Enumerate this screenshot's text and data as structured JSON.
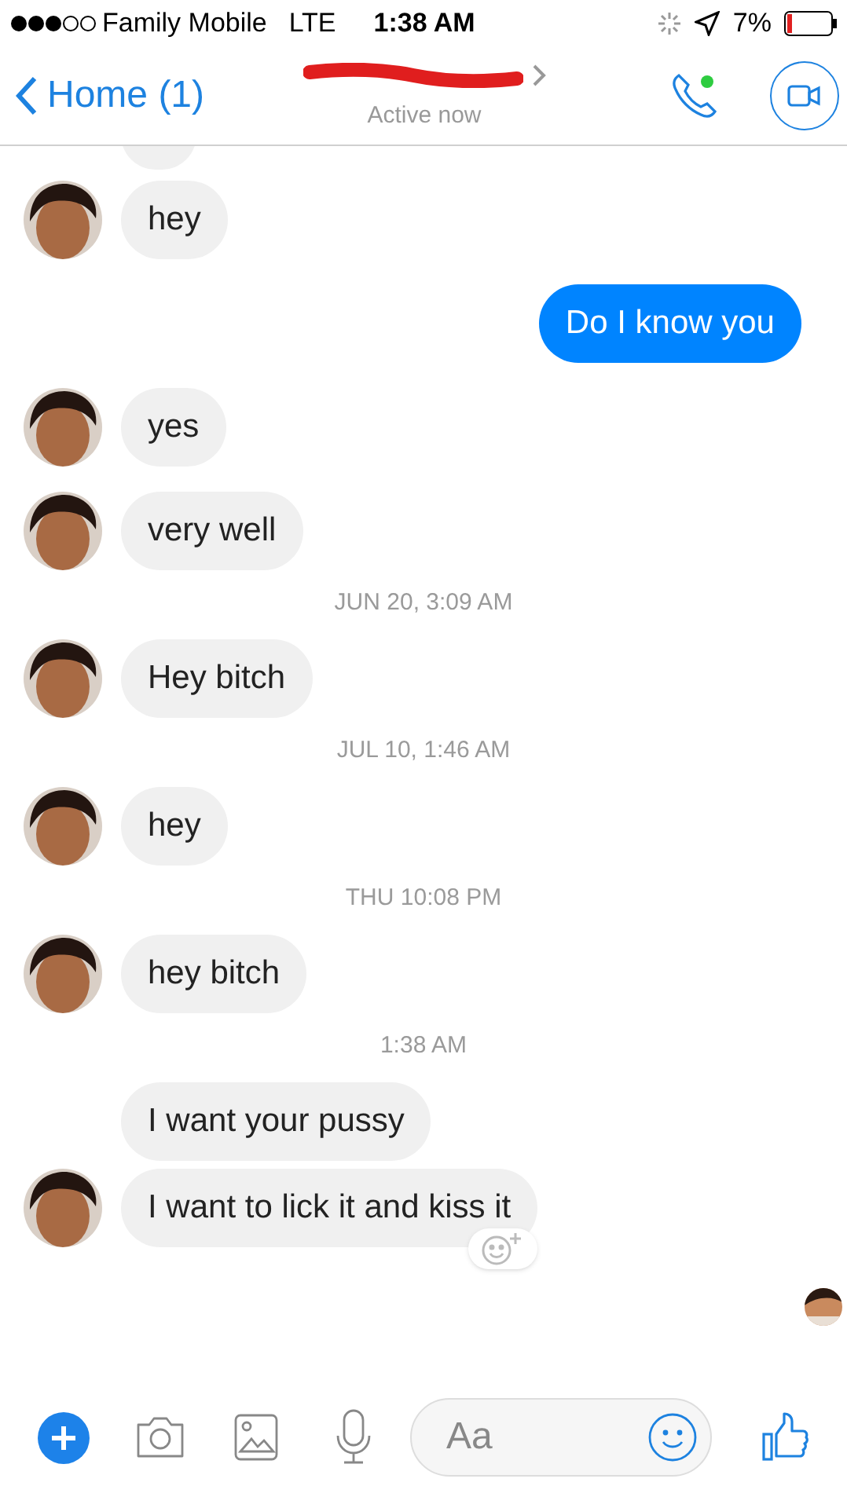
{
  "status_bar": {
    "carrier": "Family Mobile",
    "network": "LTE",
    "time": "1:38 AM",
    "battery": "7%"
  },
  "header": {
    "back": "Home (1)",
    "subtitle": "Active now"
  },
  "messages": [
    {
      "kind": "incoming",
      "text": "hey",
      "avatar": true
    },
    {
      "kind": "outgoing",
      "text": "Do I know you"
    },
    {
      "kind": "incoming",
      "text": "yes",
      "avatar": true
    },
    {
      "kind": "incoming",
      "text": "very well",
      "avatar": true
    },
    {
      "kind": "timestamp",
      "text": "JUN 20, 3:09 AM"
    },
    {
      "kind": "incoming",
      "text": "Hey bitch",
      "avatar": true
    },
    {
      "kind": "timestamp",
      "text": "JUL 10, 1:46 AM"
    },
    {
      "kind": "incoming",
      "text": "hey",
      "avatar": true
    },
    {
      "kind": "timestamp",
      "text": "THU 10:08 PM"
    },
    {
      "kind": "incoming",
      "text": "hey bitch",
      "avatar": true
    },
    {
      "kind": "timestamp",
      "text": "1:38 AM"
    },
    {
      "kind": "incoming",
      "text": "I want your pussy",
      "avatar": false
    },
    {
      "kind": "incoming",
      "text": "I want to lick it and kiss it",
      "avatar": true
    }
  ],
  "composer": {
    "placeholder": "Aa"
  }
}
